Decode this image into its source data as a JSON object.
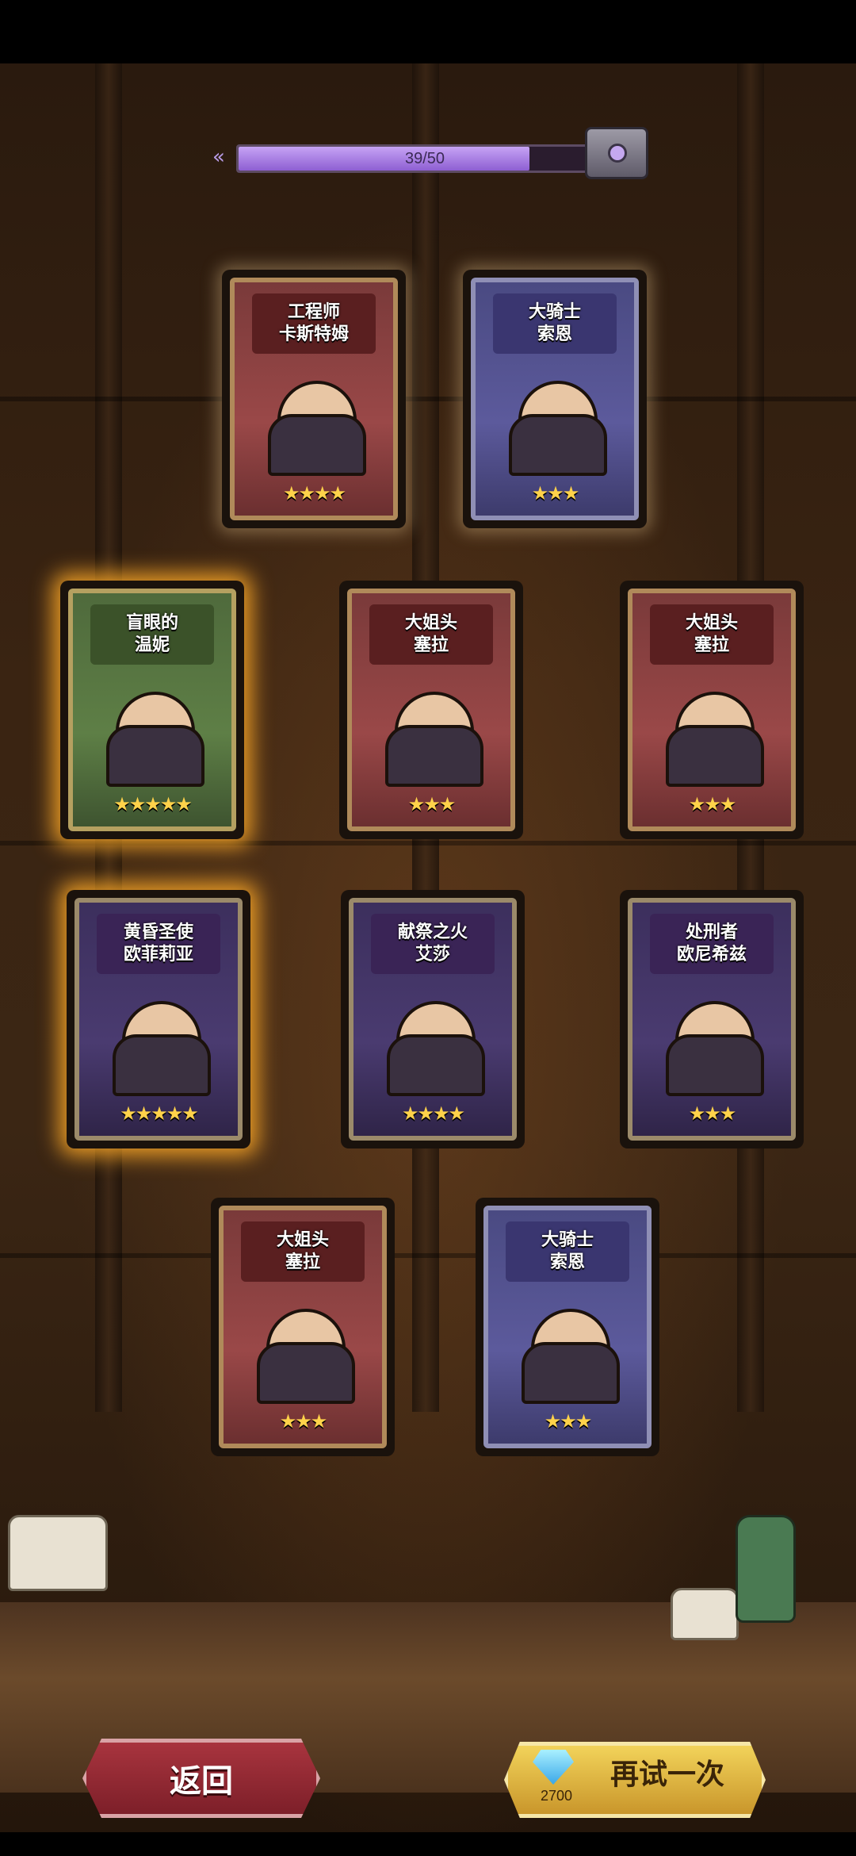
{
  "progress": {
    "current": 39,
    "max": 50,
    "label": "39/50",
    "fill_fraction": 0.78
  },
  "cards": [
    {
      "line1": "工程师",
      "line2": "卡斯特姆",
      "stars": "★★★★",
      "frame": "red",
      "glow": "dim"
    },
    {
      "line1": "大骑士",
      "line2": "索恩",
      "stars": "★★★",
      "frame": "blue",
      "glow": "dim"
    },
    {
      "line1": "盲眼的",
      "line2": "温妮",
      "stars": "★★★★★",
      "frame": "green",
      "glow": "gold"
    },
    {
      "line1": "大姐头",
      "line2": "塞拉",
      "stars": "★★★",
      "frame": "red",
      "glow": "none"
    },
    {
      "line1": "大姐头",
      "line2": "塞拉",
      "stars": "★★★",
      "frame": "red",
      "glow": "none"
    },
    {
      "line1": "黄昏圣使",
      "line2": "欧菲莉亚",
      "stars": "★★★★★",
      "frame": "purple",
      "glow": "gold"
    },
    {
      "line1": "献祭之火",
      "line2": "艾莎",
      "stars": "★★★★",
      "frame": "purple",
      "glow": "none"
    },
    {
      "line1": "处刑者",
      "line2": "欧尼希兹",
      "stars": "★★★",
      "frame": "purple",
      "glow": "none"
    },
    {
      "line1": "大姐头",
      "line2": "塞拉",
      "stars": "★★★",
      "frame": "red",
      "glow": "none"
    },
    {
      "line1": "大骑士",
      "line2": "索恩",
      "stars": "★★★",
      "frame": "blue",
      "glow": "none"
    }
  ],
  "buttons": {
    "back_label": "返回",
    "retry_label": "再试一次",
    "retry_cost": "2700"
  },
  "icons": {
    "back_arrow": "double-chevron-left-icon",
    "reward_chest": "chest-icon",
    "currency": "diamond-icon"
  },
  "colors": {
    "gold_glow": "#ffaa28",
    "progress_fill": "#a77ee0",
    "back_button": "#9a2c36",
    "retry_button": "#e0b845"
  }
}
